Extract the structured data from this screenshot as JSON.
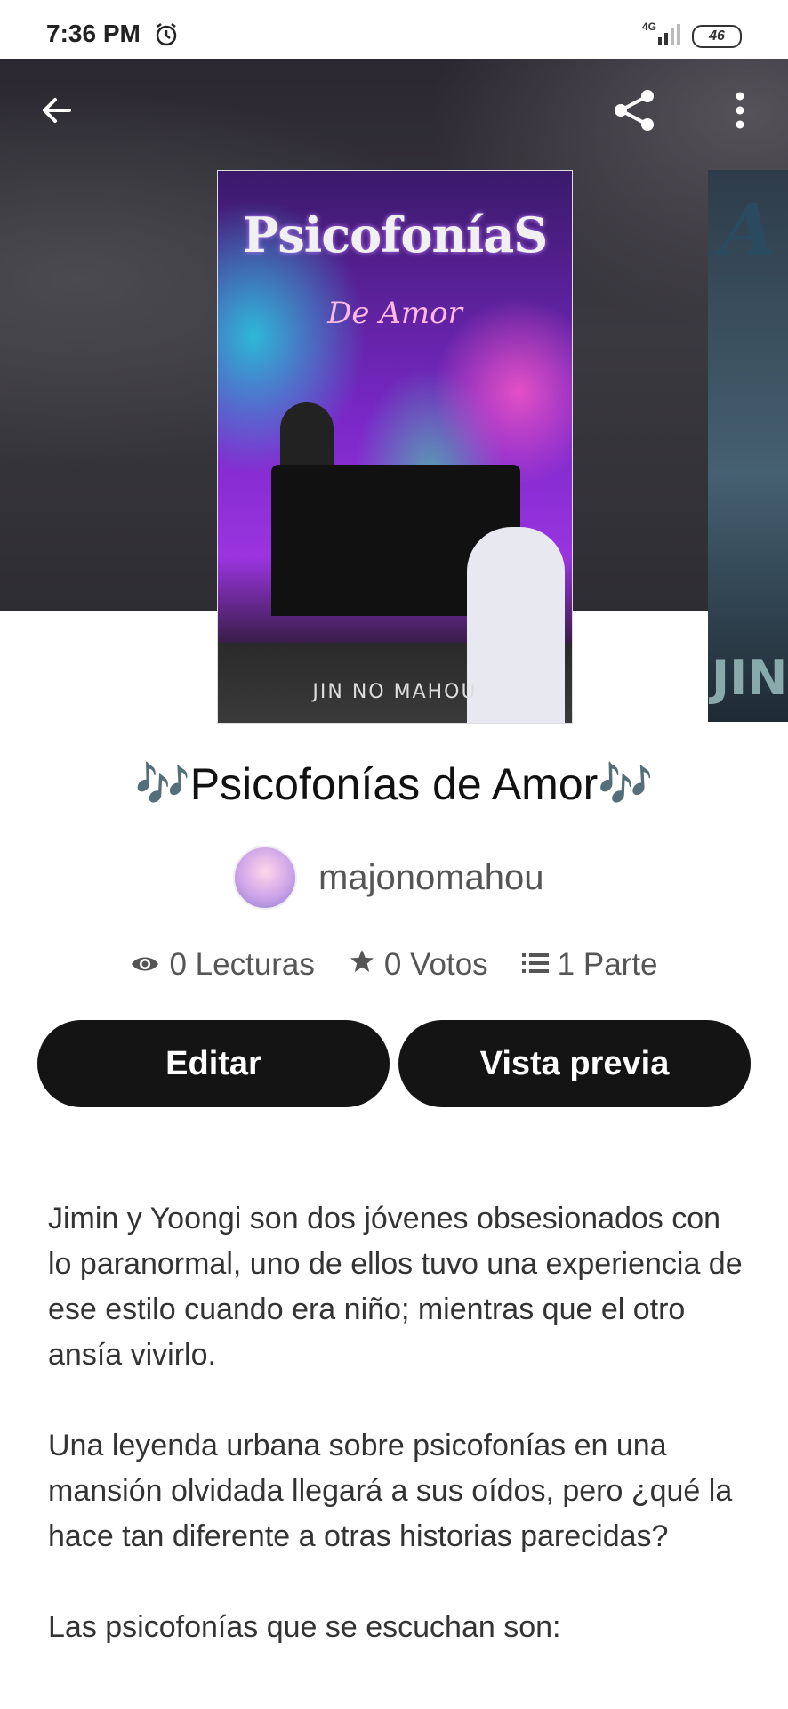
{
  "status_bar": {
    "time": "7:36 PM",
    "network": "4G",
    "battery": "46"
  },
  "header": {
    "back_icon": "arrow-left-icon",
    "share_icon": "share-icon",
    "more_icon": "more-vertical-icon"
  },
  "cover": {
    "title": "PsicofoníaS",
    "subtitle": "De Amor",
    "author_text": "JIN NO MAHOU",
    "next_cover_text": "JIN",
    "next_cover_letter": "A"
  },
  "story": {
    "title": "🎶Psicofonías de Amor🎶",
    "author": "majonomahou"
  },
  "stats": {
    "reads": "0 Lecturas",
    "votes": "0 Votos",
    "parts": "1 Parte"
  },
  "actions": {
    "edit_label": "Editar",
    "preview_label": "Vista previa"
  },
  "description": {
    "p1": "Jimin y Yoongi son dos jóvenes obsesionados con lo paranormal, uno de ellos tuvo una experiencia de ese estilo cuando era niño; mientras que el otro ansía vivirlo.",
    "p2": "Una leyenda urbana sobre psicofonías en una mansión olvidada llegará a sus oídos, pero ¿qué la hace tan diferente a otras historias parecidas?",
    "p3": "Las psicofonías que se escuchan son:"
  }
}
